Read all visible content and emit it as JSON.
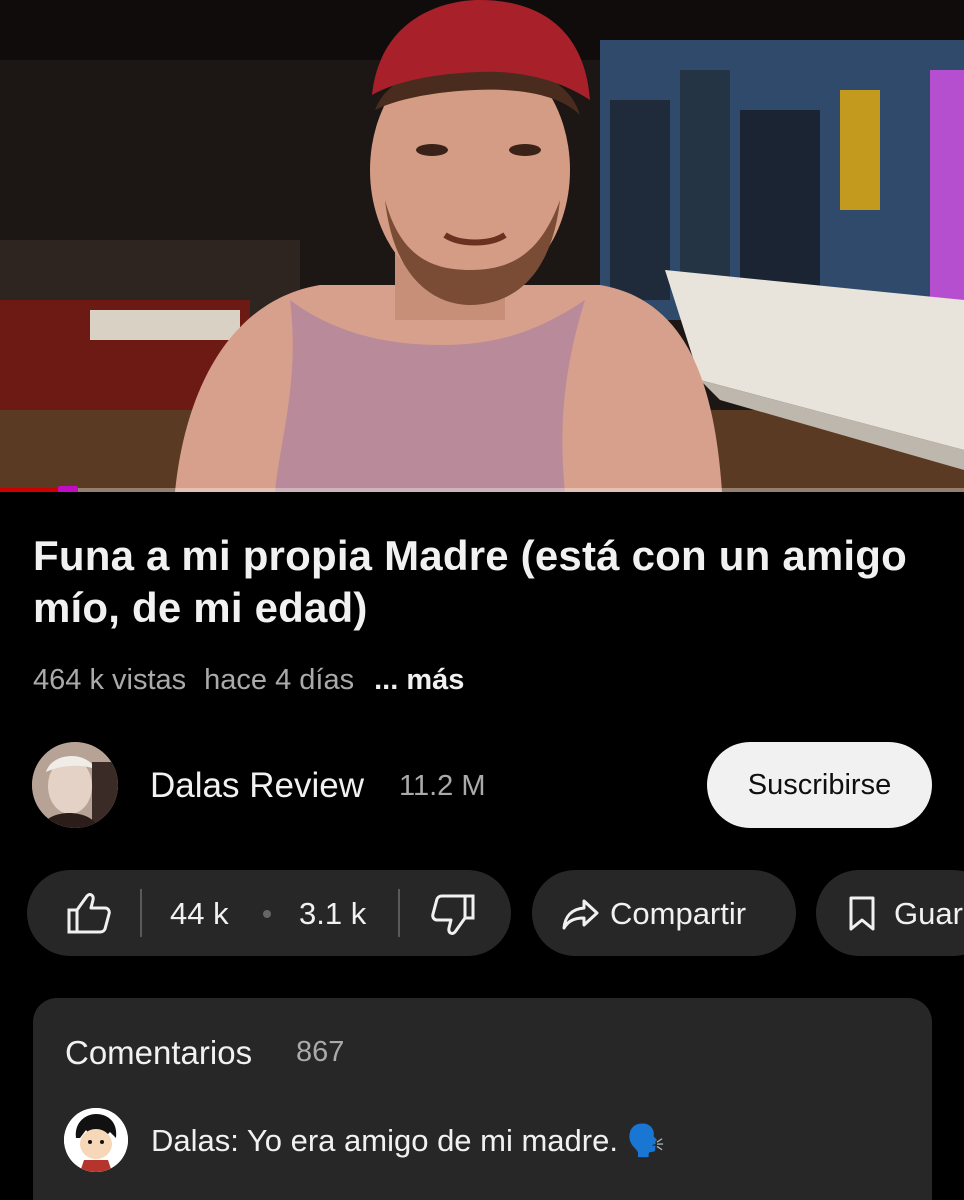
{
  "video": {
    "progress_fraction": 0.07
  },
  "title": "Funa a mi propia Madre (está con un amigo mío, de mi edad)",
  "meta": {
    "views": "464 k vistas",
    "age": "hace 4 días",
    "more": "... más"
  },
  "channel": {
    "name": "Dalas Review",
    "subscribers": "11.2 M",
    "subscribe_label": "Suscribirse"
  },
  "actions": {
    "likes": "44 k",
    "dislikes": "3.1 k",
    "share_label": "Compartir",
    "save_label": "Guar"
  },
  "comments": {
    "title": "Comentarios",
    "count": "867",
    "top_comment": "Dalas: Yo era amigo de mi madre. 🗣️"
  },
  "icons": {
    "like": "thumbs-up-icon",
    "dislike": "thumbs-down-icon",
    "share": "share-arrow-icon",
    "save": "bookmark-icon"
  },
  "colors": {
    "background": "#000000",
    "pill": "#272727",
    "subscribe_bg": "#f1f1f1",
    "progress": "#cc0000"
  }
}
